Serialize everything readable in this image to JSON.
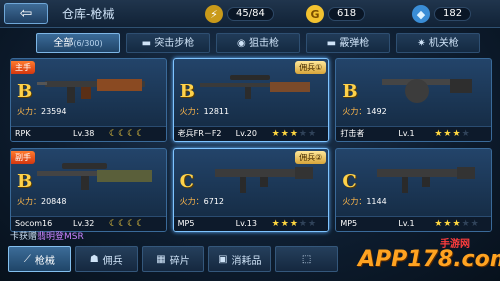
{
  "topbar": {
    "back_label": "⇦",
    "title": "仓库-枪械",
    "energy": "45/84",
    "gold": "618",
    "diamond": "182"
  },
  "tabs": [
    {
      "label": "全部",
      "count": "(6/300)"
    },
    {
      "label": "突击步枪",
      "count": ""
    },
    {
      "label": "狙击枪",
      "count": ""
    },
    {
      "label": "霰弹枪",
      "count": ""
    },
    {
      "label": "机关枪",
      "count": ""
    }
  ],
  "cards": [
    {
      "grade": "B",
      "tag": "主手",
      "merc": "",
      "power_label": "火力：",
      "power": "23594",
      "name": "RPK",
      "level": "Lv.38",
      "rating": "moon",
      "filled": 4,
      "total": 4
    },
    {
      "grade": "B",
      "tag": "",
      "merc": "佣兵①",
      "power_label": "火力：",
      "power": "12811",
      "name": "老兵FR－F2",
      "level": "Lv.20",
      "rating": "star",
      "filled": 3,
      "total": 5
    },
    {
      "grade": "B",
      "tag": "",
      "merc": "",
      "power_label": "火力：",
      "power": "1492",
      "name": "打击者",
      "level": "Lv.1",
      "rating": "star",
      "filled": 3,
      "total": 4
    },
    {
      "grade": "B",
      "tag": "副手",
      "merc": "",
      "power_label": "火力：",
      "power": "20848",
      "name": "Socom16",
      "level": "Lv.32",
      "rating": "moon",
      "filled": 4,
      "total": 4
    },
    {
      "grade": "C",
      "tag": "",
      "merc": "佣兵②",
      "power_label": "火力：",
      "power": "6712",
      "name": "MP5",
      "level": "Lv.13",
      "rating": "star",
      "filled": 3,
      "total": 5
    },
    {
      "grade": "C",
      "tag": "",
      "merc": "",
      "power_label": "火力：",
      "power": "1144",
      "name": "MP5",
      "level": "Lv.1",
      "rating": "star",
      "filled": 3,
      "total": 5
    }
  ],
  "ticker": {
    "prefix": "卡获赠",
    "highlight": "翡明登MSR"
  },
  "bottomnav": [
    {
      "label": "枪械",
      "icon": "gun-icon"
    },
    {
      "label": "佣兵",
      "icon": "soldier-icon"
    },
    {
      "label": "碎片",
      "icon": "fragment-icon"
    },
    {
      "label": "消耗品",
      "icon": "consumable-icon"
    },
    {
      "label": "",
      "icon": "box-icon"
    }
  ],
  "watermark": {
    "main": "APP178.com",
    "small": "手游网"
  },
  "colors": {
    "accent": "#7fc4ff",
    "gold": "#ffd24a",
    "power": "#ffb74a"
  }
}
